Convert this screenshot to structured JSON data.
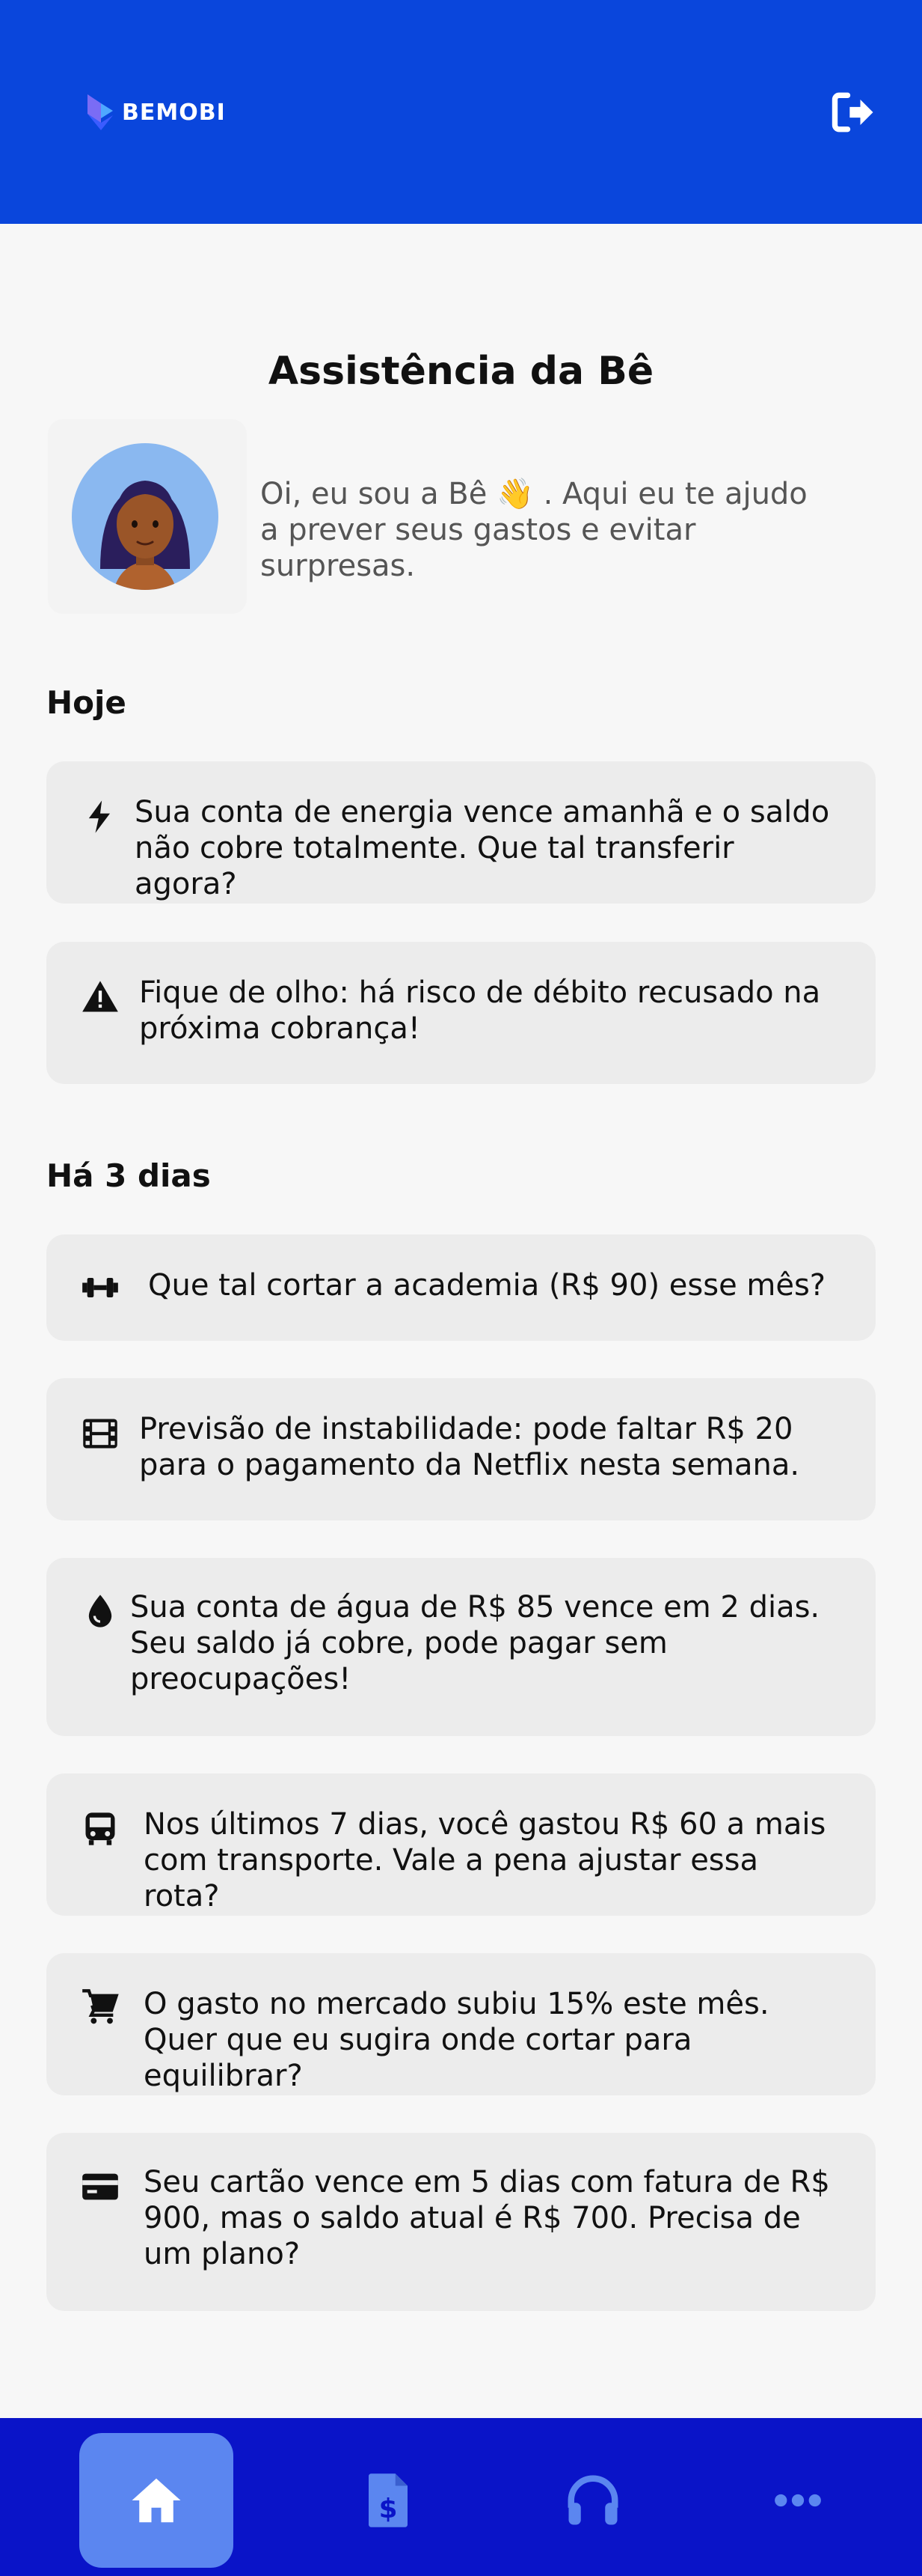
{
  "header": {
    "brand": "BEMOBI",
    "logout_icon": "logout-icon",
    "background_color": "#0a46dc"
  },
  "page": {
    "title": "Assistência da Bê",
    "intro": "Oi, eu sou a Bê 👋 . Aqui eu te ajudo a prever seus gastos e evitar surpresas."
  },
  "sections": [
    {
      "title": "Hoje",
      "items": [
        {
          "icon": "lightning-icon",
          "text": "Sua conta de energia vence amanhã e o saldo não cobre totalmente. Que tal transferir agora?"
        },
        {
          "icon": "warning-icon",
          "text": "Fique de olho: há risco de débito recusado na próxima cobrança!"
        }
      ]
    },
    {
      "title": "Há 3 dias",
      "items": [
        {
          "icon": "dumbbell-icon",
          "text": "Que tal cortar a academia (R$ 90) esse mês?"
        },
        {
          "icon": "film-icon",
          "text": "Previsão de instabilidade: pode faltar R$ 20 para o pagamento da Netflix nesta semana."
        },
        {
          "icon": "water-drop-icon",
          "text": "Sua conta de água de R$ 85 vence em 2 dias. Seu saldo já cobre, pode pagar sem preocupações!"
        },
        {
          "icon": "bus-icon",
          "text": "Nos últimos 7 dias, você gastou R$ 60 a mais com transporte. Vale a pena ajustar essa rota?"
        },
        {
          "icon": "cart-icon",
          "text": "O gasto no mercado subiu 15% este mês. Quer que eu sugira onde cortar para equilibrar?"
        },
        {
          "icon": "credit-card-icon",
          "text": "Seu cartão vence em 5 dias com fatura de R$ 900, mas o saldo atual é R$ 700. Precisa de um plano?"
        }
      ]
    }
  ],
  "bottom_nav": {
    "items": [
      {
        "icon": "home-icon",
        "active": true
      },
      {
        "icon": "invoice-icon",
        "active": false
      },
      {
        "icon": "headphones-icon",
        "active": false
      },
      {
        "icon": "more-icon",
        "active": false
      }
    ],
    "background_color": "#0a14c8",
    "active_color": "#5b86f0"
  }
}
